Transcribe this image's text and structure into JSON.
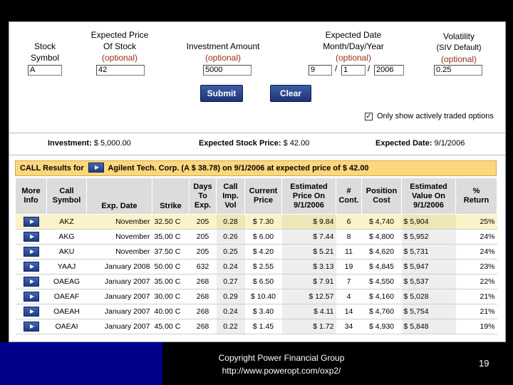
{
  "form": {
    "stock_symbol": {
      "label_line1": "Stock",
      "label_line2": "Symbol",
      "value": "A"
    },
    "expected_price": {
      "label_line1": "Expected Price",
      "label_line2": "Of Stock",
      "optional": "(optional)",
      "value": "42"
    },
    "investment": {
      "label_line1": "Investment Amount",
      "optional": "(optional)",
      "value": "5000"
    },
    "expected_date": {
      "label_line1": "Expected Date",
      "label_line2": "Month/Day/Year",
      "optional": "(optional)",
      "month": "9",
      "day": "1",
      "year": "2006",
      "separator": "/"
    },
    "volatility": {
      "label_line1": "Volatility",
      "label_line2": "(SIV Default)",
      "optional": "(optional)",
      "value": "0.25"
    },
    "submit_label": "Submit",
    "clear_label": "Clear",
    "active_only_label": "Only show actively traded options",
    "active_only_checked": "✓"
  },
  "summary": {
    "investment_label": "Investment:",
    "investment_value": "$ 5,000.00",
    "price_label": "Expected Stock Price:",
    "price_value": "$ 42.00",
    "date_label": "Expected Date:",
    "date_value": "9/1/2006"
  },
  "banner": {
    "prefix": "CALL Results for",
    "text": "Agilent Tech. Corp. (A $ 38.78)  on 9/1/2006 at expected price of $ 42.00"
  },
  "table": {
    "headers": [
      [
        "More",
        "Info"
      ],
      [
        "Call",
        "Symbol"
      ],
      [
        "Exp. Date",
        ""
      ],
      [
        "Strike",
        ""
      ],
      [
        "Days",
        "To",
        "Exp."
      ],
      [
        "Call",
        "Imp.",
        "Vol"
      ],
      [
        "Current",
        "Price"
      ],
      [
        "Estimated",
        "Price On",
        "9/1/2006"
      ],
      [
        "#",
        "Cont."
      ],
      [
        "Position",
        "Cost"
      ],
      [
        "Estimated",
        "Value On",
        "9/1/2006"
      ],
      [
        "%",
        "Return"
      ]
    ],
    "rows": [
      [
        "AKZ",
        "November",
        "32.50 C",
        "205",
        "0.28",
        "$ 7.30",
        "$ 9.84",
        "6",
        "$ 4,740",
        "$ 5,904",
        "25%"
      ],
      [
        "AKG",
        "November",
        "35.00 C",
        "205",
        "0.26",
        "$ 6.00",
        "$ 7.44",
        "8",
        "$ 4,800",
        "$ 5,952",
        "24%"
      ],
      [
        "AKU",
        "November",
        "37.50 C",
        "205",
        "0.25",
        "$ 4.20",
        "$ 5.21",
        "11",
        "$ 4,620",
        "$ 5,731",
        "24%"
      ],
      [
        "YAAJ",
        "January 2008",
        "50.00 C",
        "632",
        "0.24",
        "$ 2.55",
        "$ 3.13",
        "19",
        "$ 4,845",
        "$ 5,947",
        "23%"
      ],
      [
        "OAEAG",
        "January 2007",
        "35.00 C",
        "268",
        "0.27",
        "$ 6.50",
        "$ 7.91",
        "7",
        "$ 4,550",
        "$ 5,537",
        "22%"
      ],
      [
        "OAEAF",
        "January 2007",
        "30.00 C",
        "268",
        "0.29",
        "$ 10.40",
        "$ 12.57",
        "4",
        "$ 4,160",
        "$ 5,028",
        "21%"
      ],
      [
        "OAEAH",
        "January 2007",
        "40.00 C",
        "268",
        "0.24",
        "$ 3.40",
        "$ 4.11",
        "14",
        "$ 4,760",
        "$ 5,754",
        "21%"
      ],
      [
        "OAEAI",
        "January 2007",
        "45.00 C",
        "268",
        "0.22",
        "$ 1.45",
        "$ 1.72",
        "34",
        "$ 4,930",
        "$ 5,848",
        "19%"
      ]
    ]
  },
  "footer": {
    "line1": "Copyright Power Financial Group",
    "line2": "http://www.poweropt.com/oxp2/",
    "page_number": "19"
  },
  "colors": {
    "banner_bg": "#fdd77e",
    "button_bg": "#1d3478",
    "slide_bg": "#000000",
    "accent_stripe": "#00008a",
    "optional_text": "#9a2d18"
  }
}
